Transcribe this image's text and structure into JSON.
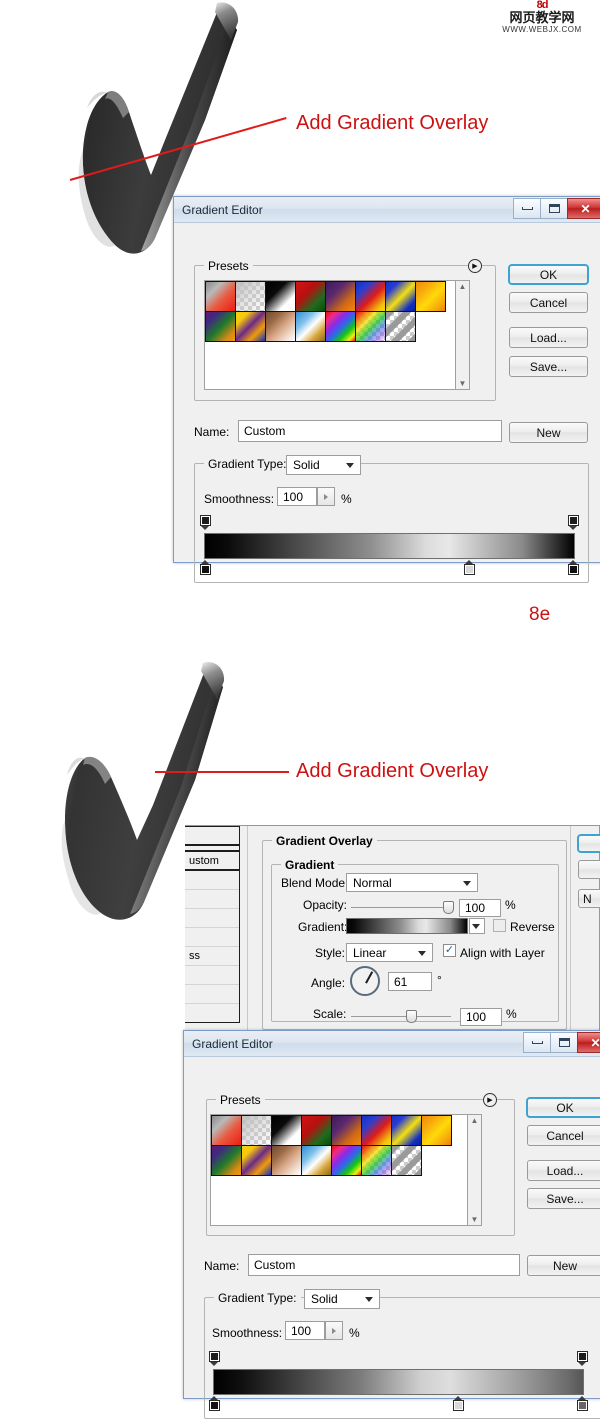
{
  "watermark": {
    "logo": "8d",
    "cn_text": "网页教学网",
    "url": "WWW.WEBJX.COM"
  },
  "annotations": [
    {
      "text": "Add Gradient Overlay",
      "id": "annotation-1"
    },
    {
      "text": "Add Gradient Overlay",
      "id": "annotation-2"
    }
  ],
  "step_label": "8e",
  "gradient_editor": {
    "title": "Gradient Editor",
    "window_buttons": {
      "minimize": "minimize-icon",
      "maximize": "maximize-icon",
      "close": "✕"
    },
    "presets_legend": "Presets",
    "presets_menu_icon": "▶",
    "buttons": {
      "ok": "OK",
      "cancel": "Cancel",
      "load": "Load...",
      "save": "Save...",
      "new": "New"
    },
    "name_label": "Name:",
    "name_value": "Custom",
    "gradient_type_label": "Gradient Type:",
    "gradient_type_value": "Solid",
    "smoothness_label": "Smoothness:",
    "smoothness_value": "100",
    "percent_sign": "%",
    "presets": [
      {
        "name": "foreground-to-background",
        "css": "linear-gradient(135deg,#8a8a8a 0%,#b9b9b9 28%,#e85b42 58%,#ee1c12 100%)"
      },
      {
        "name": "foreground-to-transparent",
        "css": "none",
        "checker": true,
        "overlay": "linear-gradient(135deg,rgba(190,190,190,1) 0%,rgba(200,200,200,0.55) 45%,rgba(210,210,210,0) 100%)"
      },
      {
        "name": "black-white",
        "css": "linear-gradient(135deg,#000 0%,#0a0a0a 35%,#ffffff 72%,#ffffff 100%)"
      },
      {
        "name": "red-green",
        "css": "linear-gradient(135deg,#cf1414 0%,#b81010 38%,#1f6b1f 72%,#0a4b0a 100%)"
      },
      {
        "name": "violet-orange",
        "css": "linear-gradient(135deg,#3b1a5c 0%,#5c2a6e 35%,#d46a12 72%,#f08a0b 100%)"
      },
      {
        "name": "blue-red-yellow",
        "css": "linear-gradient(135deg,#1330c4 0%,#2a3ed0 25%,#e01a1a 55%,#f2c20d 85%,#ffd700 100%)"
      },
      {
        "name": "blue-yellow-blue",
        "css": "linear-gradient(135deg,#1330c4 0%,#2a3ed0 22%,#f5e010 52%,#1330c4 82%,#0a1f9c 100%)"
      },
      {
        "name": "orange-yellow-orange",
        "css": "linear-gradient(135deg,#f08a0b 0%,#f7a80d 25%,#ffd90a 55%,#f5a20b 85%,#ef7f08 100%)"
      },
      {
        "name": "violet-green-orange",
        "css": "linear-gradient(135deg,#5a1a78 0%,#3f2a80 22%,#1f7a2a 52%,#d98a12 82%,#f29a08 100%)"
      },
      {
        "name": "yellow-violet-orange-blue",
        "css": "linear-gradient(135deg,#f5d010 0%,#f7c80d 22%,#6a2a8a 48%,#f09a0b 72%,#1430b4 100%)"
      },
      {
        "name": "copper",
        "css": "linear-gradient(135deg,#6e4a32 0%,#9c6b46 28%,#d9a888 55%,#f0ded0 80%,#ffffff 100%)"
      },
      {
        "name": "chrome",
        "css": "linear-gradient(135deg,#2f8fd8 0%,#7fc0ea 30%,#ffffff 52%,#d6a53a 76%,#8a6a1a 100%)"
      },
      {
        "name": "spectrum",
        "css": "linear-gradient(135deg,#e81010 0%,#f02a8a 18%,#8a2ae8 36%,#2a6ae8 54%,#12c812 72%,#f0f010 88%,#e81010 100%)"
      },
      {
        "name": "transparent-rainbow",
        "css": "none",
        "checker": true,
        "overlay": "linear-gradient(135deg,rgba(232,16,16,1) 0%,rgba(240,120,10,0.9) 18%,rgba(245,225,16,0.8) 34%,rgba(18,200,18,0.7) 52%,rgba(42,106,232,0.6) 70%,rgba(138,42,232,0.4) 86%,rgba(232,16,16,0) 100%)"
      },
      {
        "name": "transparent-stripes",
        "css": "none",
        "checker": true,
        "overlay": "repeating-linear-gradient(135deg,#9a9a9a 0px,#9a9a9a 6px,rgba(255,255,255,0) 6px,rgba(255,255,255,0) 12px)"
      }
    ],
    "gradient_bar": {
      "preview": "black-to-light-to-black",
      "top_stops": [
        {
          "pos": 0,
          "color": "#1c1c1c"
        },
        {
          "pos": 100,
          "color": "#1c1c1c"
        }
      ],
      "bottom_stops": [
        {
          "pos": 0,
          "color": "#111111"
        },
        {
          "pos": 72,
          "color": "#d8d8d8"
        },
        {
          "pos": 100,
          "color": "#111111"
        }
      ]
    }
  },
  "gradient_editor_2": {
    "title": "Gradient Editor",
    "presets_legend": "Presets",
    "buttons": {
      "ok": "OK",
      "cancel": "Cancel",
      "load": "Load...",
      "save": "Save...",
      "new": "New"
    },
    "name_label": "Name:",
    "name_value": "Custom",
    "gradient_type_label": "Gradient Type:",
    "gradient_type_value": "Solid",
    "smoothness_label": "Smoothness:",
    "smoothness_value": "100",
    "percent_sign": "%",
    "gradient_bar": {
      "top_stops": [
        {
          "pos": 0,
          "color": "#1c1c1c"
        },
        {
          "pos": 100,
          "color": "#1c1c1c"
        }
      ],
      "bottom_stops": [
        {
          "pos": 0,
          "color": "#111111"
        },
        {
          "pos": 66,
          "color": "#d8d8d8"
        },
        {
          "pos": 100,
          "color": "#666666"
        }
      ]
    }
  },
  "layer_style": {
    "left_list_partial": [
      "ustom",
      "ss"
    ],
    "section_title": "Gradient Overlay",
    "gradient_group": "Gradient",
    "blend_mode_label": "Blend Mode:",
    "blend_mode_value": "Normal",
    "opacity_label": "Opacity:",
    "opacity_value": "100",
    "gradient_label": "Gradient:",
    "reverse_label": "Reverse",
    "reverse_checked": false,
    "style_label": "Style:",
    "style_value": "Linear",
    "align_label": "Align with Layer",
    "align_checked": true,
    "angle_label": "Angle:",
    "angle_value": "61",
    "degree_sign": "°",
    "scale_label": "Scale:",
    "scale_value": "100",
    "percent_sign": "%",
    "right_buttons": [
      "",
      "",
      "N"
    ]
  },
  "colors": {
    "annotation_red": "#cc1111",
    "dialog_bg": "#f0f0f0",
    "titlebar_border": "#7a9cc6",
    "default_button_focus": "#3fa3d0"
  }
}
